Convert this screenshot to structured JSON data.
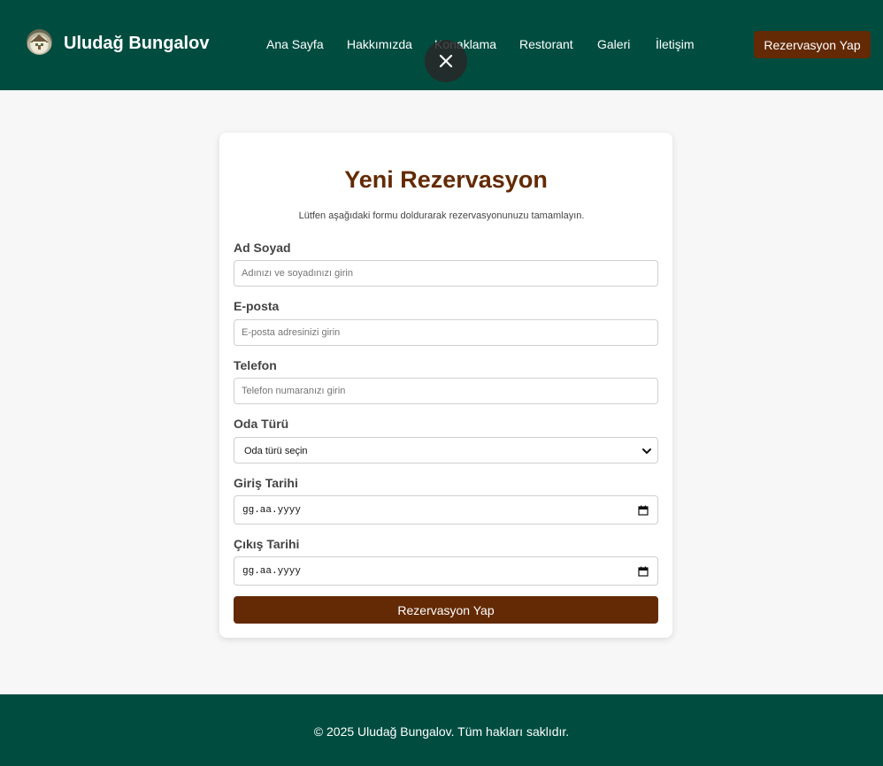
{
  "header": {
    "brand": "Uludağ Bungalov",
    "nav": [
      "Ana Sayfa",
      "Hakkımızda",
      "Konaklama",
      "Restorant",
      "Galeri",
      "İletişim"
    ],
    "cta_label": "Rezervasyon Yap"
  },
  "form": {
    "title": "Yeni Rezervasyon",
    "subtitle": "Lütfen aşağıdaki formu doldurarak rezervasyonunuzu tamamlayın.",
    "name_label": "Ad Soyad",
    "name_placeholder": "Adınızı ve soyadınızı girin",
    "email_label": "E-posta",
    "email_placeholder": "E-posta adresinizi girin",
    "phone_label": "Telefon",
    "phone_placeholder": "Telefon numaranızı girin",
    "room_label": "Oda Türü",
    "room_selected": "Oda türü seçin",
    "checkin_label": "Giriş Tarihi",
    "checkin_value": "gg.aa.yyyy",
    "checkout_label": "Çıkış Tarihi",
    "checkout_value": "gg.aa.yyyy",
    "submit_label": "Rezervasyon Yap"
  },
  "footer": {
    "text": "© 2025 Uludağ Bungalov. Tüm hakları saklıdır."
  },
  "colors": {
    "primary": "#004d40",
    "accent": "#632a05",
    "background": "#f7f7f7"
  },
  "icons": [
    "house-logo-icon",
    "close-icon",
    "chevron-down-icon",
    "calendar-icon"
  ]
}
